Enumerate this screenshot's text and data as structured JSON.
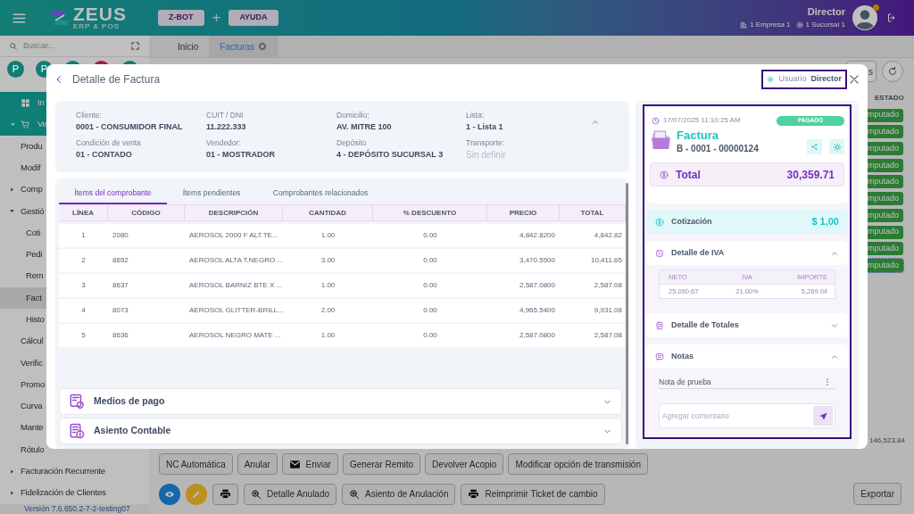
{
  "header": {
    "logo_name": "ZEUS",
    "logo_tagline": "ERP & POS",
    "buttons": [
      {
        "label": "Z-BOT"
      },
      {
        "label": "AYUDA"
      }
    ],
    "button_separator": "+",
    "user_name": "Director",
    "company": "1 Empresa 1",
    "branch": "1 Sucursal 1"
  },
  "sidebar": {
    "search": {
      "placeholder": "Buscar..."
    },
    "avatars": [
      {
        "letter": "P",
        "color": "#0f7e77"
      },
      {
        "letter": "P",
        "color": "#0f7e77"
      },
      {
        "color": "#0f7e77"
      },
      {
        "color": "#af174a"
      },
      {
        "color": "#0f7e77"
      }
    ],
    "menu": [
      {
        "label": "In",
        "kind": "section",
        "selected": false
      },
      {
        "label": "Ve",
        "kind": "section",
        "expanded": true,
        "selected": false,
        "children": [
          {
            "label": "Produ",
            "selected": false
          },
          {
            "label": "Modif",
            "selected": false
          },
          {
            "label": "Comp",
            "expanded": false,
            "selected": false
          },
          {
            "label": "Gestió",
            "expanded": true,
            "selected": false,
            "children": [
              {
                "label": "Coti",
                "selected": false
              },
              {
                "label": "Pedi",
                "selected": false
              },
              {
                "label": "Rem",
                "selected": false
              },
              {
                "label": "Fact",
                "selected": true
              },
              {
                "label": "Histo",
                "selected": false
              }
            ]
          },
          {
            "label": "Cálcul",
            "selected": false
          },
          {
            "label": "Verific",
            "selected": false
          },
          {
            "label": "Promo",
            "selected": false
          },
          {
            "label": "Curva",
            "selected": false
          },
          {
            "label": "Mante",
            "selected": false
          },
          {
            "label": "Rótulo",
            "selected": false
          },
          {
            "label": "Facturación Recurrente",
            "expanded": false,
            "selected": false
          },
          {
            "label": "Fidelización de Clientes",
            "expanded": false,
            "selected": false
          }
        ]
      }
    ],
    "version": "Versión 7.6.650.2-7-2-testing07"
  },
  "tabs": [
    {
      "label": "Inicio",
      "selected": false,
      "closable": false
    },
    {
      "label": "Facturas",
      "selected": true,
      "closable": true
    }
  ],
  "top_actions": [
    {
      "kind": "text",
      "label": "s"
    },
    {
      "kind": "refresh"
    }
  ],
  "grid": {
    "status_column": "ESTADO",
    "status_badges": [
      {
        "label": "mputado",
        "selected": false
      },
      {
        "label": "mputado",
        "selected": false
      },
      {
        "label": "mputado",
        "selected": false
      },
      {
        "label": "mputado",
        "selected": false
      },
      {
        "label": "mputado",
        "selected": false
      },
      {
        "label": "mputado",
        "selected": false
      },
      {
        "label": "mputado",
        "selected": false
      },
      {
        "label": "mputado",
        "selected": false
      },
      {
        "label": "mputado",
        "selected": false
      },
      {
        "label": "mputado",
        "selected": true
      }
    ],
    "grand_total": "146,523.84"
  },
  "actions_row_1": [
    {
      "kind": "text",
      "label": "NC Automática"
    },
    {
      "kind": "text",
      "label": "Anular"
    },
    {
      "kind": "mail",
      "label": "Enviar"
    },
    {
      "kind": "text",
      "label": "Generar Remito"
    },
    {
      "kind": "text",
      "label": "Devolver Acopio"
    },
    {
      "kind": "text",
      "label": "Modificar opción de transmisión"
    }
  ],
  "actions_row_2": [
    {
      "kind": "view"
    },
    {
      "kind": "edit"
    },
    {
      "kind": "print"
    },
    {
      "kind": "zoom",
      "label": "Detalle Anulado"
    },
    {
      "kind": "zoom",
      "label": "Asiento de Anulación"
    },
    {
      "kind": "print",
      "label": "Reimprimir Ticket de cambio"
    }
  ],
  "export_button": "Exportar",
  "modal": {
    "title": "Detalle de Factura",
    "user_label": "Usuario",
    "user_value": "Director",
    "info_expanded": true,
    "info": [
      {
        "label": "Cliente:",
        "value": "0001 - CONSUMIDOR FINAL",
        "empty": false
      },
      {
        "label": "CUIT / DNI",
        "value": "11.222.333",
        "empty": false
      },
      {
        "label": "Domicilio:",
        "value": "AV. MITRE 100",
        "empty": false
      },
      {
        "label": "Lista:",
        "value": "1 - Lista 1",
        "empty": false
      },
      {
        "label": "Condición de venta",
        "value": "01 - CONTADO",
        "empty": false
      },
      {
        "label": "Vendedor:",
        "value": "01 - MOSTRADOR",
        "empty": false
      },
      {
        "label": "Depósito",
        "value": "4 - DEPÓSITO SUCURSAL 3",
        "empty": false
      },
      {
        "label": "Transporte:",
        "value": "Sin definir",
        "empty": true
      }
    ],
    "tabs": [
      {
        "label": "Ítems del comprobante",
        "selected": true
      },
      {
        "label": "Ítems pendientes",
        "selected": false
      },
      {
        "label": "Comprobantes relacionados",
        "selected": false
      }
    ],
    "table": {
      "columns": [
        "LÍNEA",
        "CÓDIGO",
        "DESCRIPCIÓN",
        "CANTIDAD",
        "% DESCUENTO",
        "PRECIO",
        "TOTAL"
      ],
      "rows": [
        [
          "1",
          "2080",
          "AEROSOL 2000 F ALT.TE...",
          "1.00",
          "0.00",
          "4,842.8200",
          "4,842.82"
        ],
        [
          "2",
          "8652",
          "AEROSOL ALTA T.NEGRO ...",
          "3.00",
          "0.00",
          "3,470.5500",
          "10,411.65"
        ],
        [
          "3",
          "8637",
          "AEROSOL BARNIZ BTE X ...",
          "1.00",
          "0.00",
          "2,587.0800",
          "2,587.08"
        ],
        [
          "4",
          "8073",
          "AEROSOL GLITTER-BRILL...",
          "2.00",
          "0.00",
          "4,965.5400",
          "9,931.08"
        ],
        [
          "5",
          "8636",
          "AEROSOL NEGRO MATE ...",
          "1.00",
          "0.00",
          "2,587.0800",
          "2,587.08"
        ]
      ]
    },
    "accordions": [
      {
        "kind": "payment",
        "label": "Medios de pago",
        "expanded": false
      },
      {
        "kind": "accounting",
        "label": "Asiento Contable",
        "expanded": false
      }
    ],
    "summary": {
      "date": "17/07/2025 11:10:25 AM",
      "status": "PAGADO",
      "doc_type": "Factura",
      "doc_number": "B - 0001 - 00000124",
      "total_label": "Total",
      "total": "30,359.71",
      "rate_label": "Cotización",
      "rate": "$ 1,00",
      "sections": [
        {
          "kind": "iva",
          "title": "Detalle de IVA",
          "expanded": true,
          "columns": [
            "NETO",
            "IVA",
            "IMPORTE"
          ],
          "rows": [
            [
              "25,090.67",
              "21.00%",
              "5,269.04"
            ]
          ]
        },
        {
          "kind": "totals",
          "title": "Detalle de Totales",
          "expanded": false
        },
        {
          "kind": "notes",
          "title": "Notas",
          "expanded": true,
          "notes": [
            "Nota de prueba"
          ],
          "comment_placeholder": "Agregar comentario"
        }
      ]
    }
  }
}
